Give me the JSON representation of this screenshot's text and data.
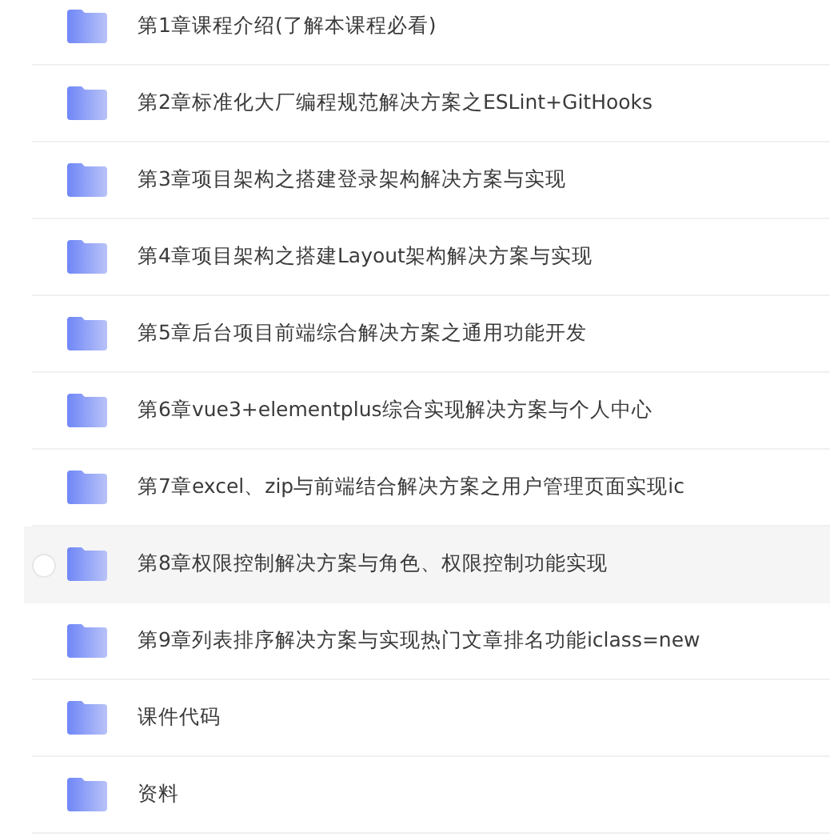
{
  "folders": [
    {
      "name": "第1章课程介绍(了解本课程必看)",
      "hovered": false
    },
    {
      "name": "第2章标准化大厂编程规范解决方案之ESLint+GitHooks",
      "hovered": false
    },
    {
      "name": "第3章项目架构之搭建登录架构解决方案与实现",
      "hovered": false
    },
    {
      "name": "第4章项目架构之搭建Layout架构解决方案与实现",
      "hovered": false
    },
    {
      "name": "第5章后台项目前端综合解决方案之通用功能开发",
      "hovered": false
    },
    {
      "name": "第6章vue3+elementplus综合实现解决方案与个人中心",
      "hovered": false
    },
    {
      "name": "第7章excel、zip与前端结合解决方案之用户管理页面实现ic",
      "hovered": false
    },
    {
      "name": "第8章权限控制解决方案与角色、权限控制功能实现",
      "hovered": true
    },
    {
      "name": "第9章列表排序解决方案与实现热门文章排名功能iclass=new",
      "hovered": false
    },
    {
      "name": "课件代码",
      "hovered": false
    },
    {
      "name": "资料",
      "hovered": false
    }
  ]
}
